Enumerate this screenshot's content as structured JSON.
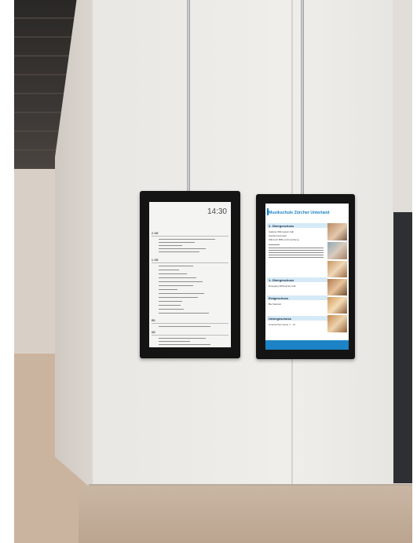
{
  "left_display": {
    "time": "14:30",
    "sections": [
      "2. OG",
      "1. OG",
      "EG",
      "UG"
    ]
  },
  "right_display": {
    "school_name": "Musikschule Zürcher Unterland",
    "floors": [
      {
        "title": "2. Obergeschoss",
        "rooms": [
          "Gallerie Willmspieln hall",
          "Kanttenraumsaal",
          "Willmsch BIB und Forschung"
        ]
      },
      {
        "title": "1. Obergeschoss",
        "rooms": [
          "Empgang Willmspieln hall"
        ]
      },
      {
        "title": "Erdgeschoss",
        "rooms": [
          "Bis Standort"
        ]
      },
      {
        "title": "Untergeschoss",
        "rooms": [
          "Unterkirchenmauer 1 · 13"
        ]
      }
    ]
  },
  "colors": {
    "accent_blue": "#1b83c6",
    "display_bezel": "#141414",
    "wall": "#ecebe7",
    "floor": "#c4ad97"
  }
}
